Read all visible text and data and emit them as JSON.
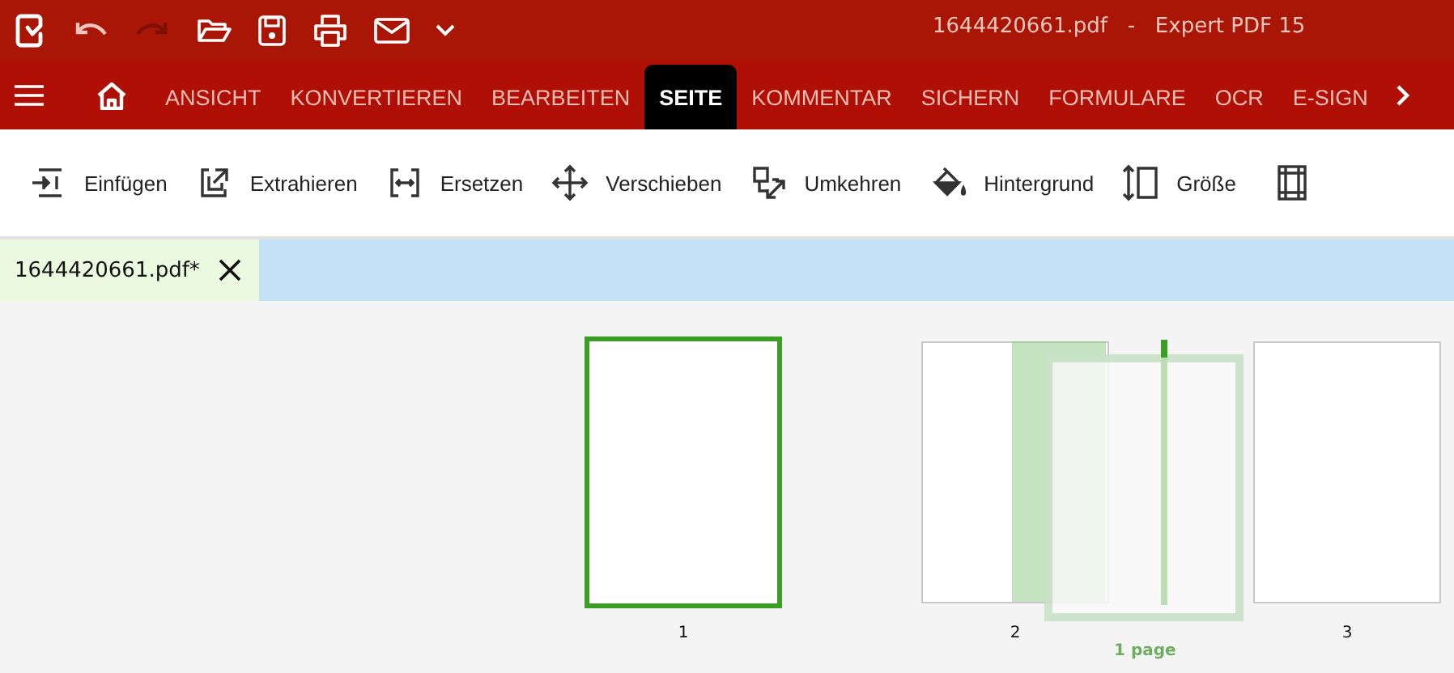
{
  "window": {
    "title": "1644420661.pdf   -   Expert PDF 15"
  },
  "menu": [
    {
      "label": "ANSICHT",
      "selected": false
    },
    {
      "label": "KONVERTIEREN",
      "selected": false
    },
    {
      "label": "BEARBEITEN",
      "selected": false
    },
    {
      "label": "SEITE",
      "selected": true
    },
    {
      "label": "KOMMENTAR",
      "selected": false
    },
    {
      "label": "SICHERN",
      "selected": false
    },
    {
      "label": "FORMULARE",
      "selected": false
    },
    {
      "label": "OCR",
      "selected": false
    },
    {
      "label": "E-SIGN",
      "selected": false
    }
  ],
  "toolbar": [
    {
      "label": "Einfügen",
      "kind": "insert"
    },
    {
      "label": "Extrahieren",
      "kind": "extract"
    },
    {
      "label": "Ersetzen",
      "kind": "replace"
    },
    {
      "label": "Verschieben",
      "kind": "move"
    },
    {
      "label": "Umkehren",
      "kind": "reverse"
    },
    {
      "label": "Hintergrund",
      "kind": "background"
    },
    {
      "label": "Größe",
      "kind": "size"
    }
  ],
  "document_tab": {
    "label": "1644420661.pdf*"
  },
  "pages": [
    {
      "label": "1",
      "selected": true
    },
    {
      "label": "2",
      "selected": false
    },
    {
      "label": "3",
      "selected": false
    }
  ],
  "drag": {
    "label": "1 page"
  }
}
